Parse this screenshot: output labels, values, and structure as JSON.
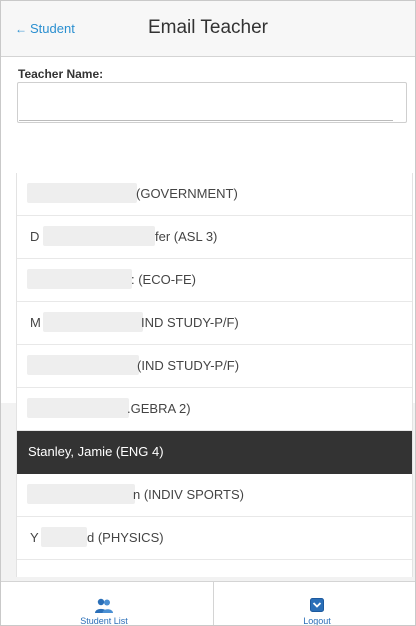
{
  "header": {
    "back_label": "Student",
    "title": "Email Teacher"
  },
  "form": {
    "teacher_name_label": "Teacher Name:",
    "teacher_name_value": ""
  },
  "list": {
    "items": [
      {
        "prefix": "",
        "text": "(GOVERNMENT)",
        "selected": false
      },
      {
        "prefix": "D",
        "text": "fer (ASL 3)",
        "selected": false
      },
      {
        "prefix": "",
        "text": ": (ECO-FE)",
        "selected": false
      },
      {
        "prefix": "M",
        "text": "IND STUDY-P/F)",
        "selected": false
      },
      {
        "prefix": "",
        "text": "(IND STUDY-P/F)",
        "selected": false
      },
      {
        "prefix": "",
        "text": ".GEBRA 2)",
        "selected": false
      },
      {
        "prefix": "",
        "text": "Stanley, Jamie (ENG 4)",
        "selected": true
      },
      {
        "prefix": "",
        "text": "n (INDIV SPORTS)",
        "selected": false
      },
      {
        "prefix": "Y",
        "text": "d (PHYSICS)",
        "selected": false
      }
    ]
  },
  "footer": {
    "student_list_label": "Student List",
    "logout_label": "Logout",
    "student_list_icon": "users-icon",
    "logout_icon": "chevron-down-icon"
  },
  "colors": {
    "link": "#2a8fd0",
    "selected_bg": "#333333"
  }
}
